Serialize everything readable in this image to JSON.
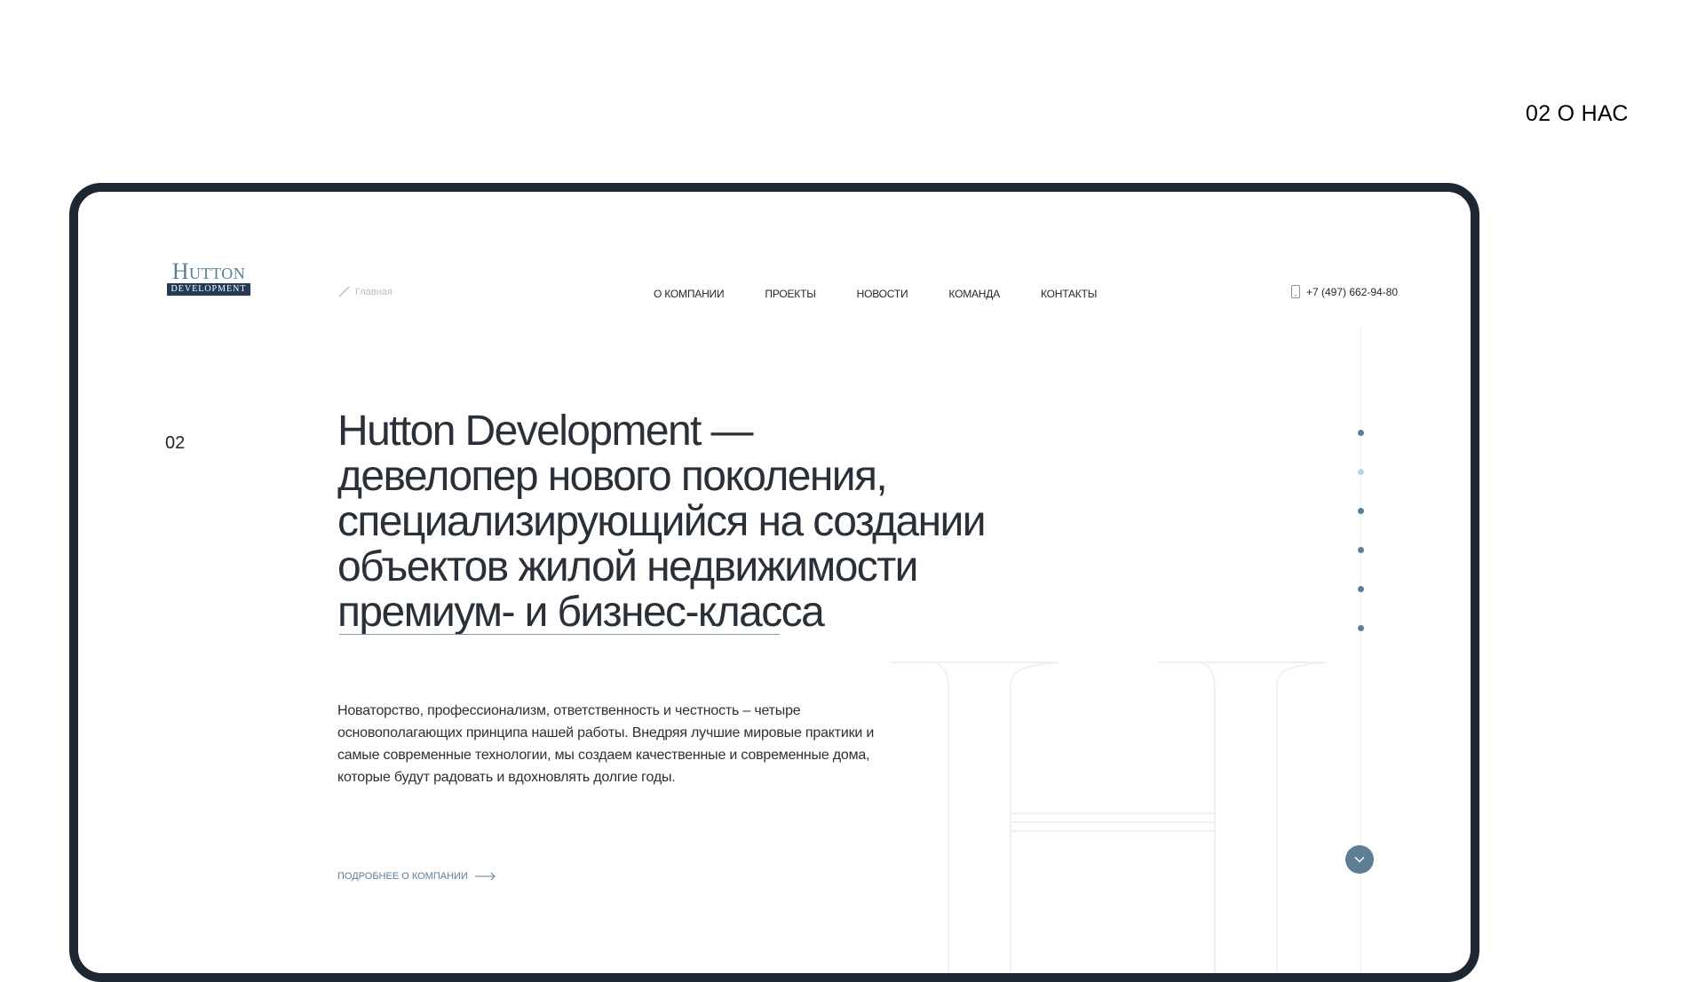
{
  "page_label": "02 О НАС",
  "logo": {
    "top": "Hutton",
    "bottom": "DEVELOPMENT"
  },
  "breadcrumb": {
    "label": "Главная",
    "icon": "slash-icon"
  },
  "nav": {
    "items": [
      {
        "label": "О КОМПАНИИ"
      },
      {
        "label": "ПРОЕКТЫ"
      },
      {
        "label": "НОВОСТИ"
      },
      {
        "label": "КОМАНДА"
      },
      {
        "label": "КОНТАКТЫ"
      }
    ]
  },
  "phone": {
    "number": "+7 (497) 662-94-80",
    "icon": "phone-icon"
  },
  "section": {
    "number": "02",
    "headline": [
      "Hutton Development —",
      "девелопер нового поколения,",
      "специализирующийся на создании",
      "объектов жилой недвижимости",
      "премиум- и бизнес-класса"
    ],
    "paragraph": "Новаторство, профессионализм, ответственность и честность – четыре основополагающих принципа нашей работы. Внедряя лучшие мировые практики и самые современные технологии, мы создаем качественные и современные дома, которые будут радовать и вдохновлять долгие годы.",
    "more_link": "ПОДРОБНЕЕ О КОМПАНИИ",
    "more_icon": "arrow-right-icon"
  },
  "pagination": {
    "count": 6,
    "active_index": 1
  },
  "scroll_button_icon": "chevron-down-icon",
  "colors": {
    "accent": "#5d7f95",
    "frame": "#1d2632",
    "logo_blue": "#253a55"
  }
}
